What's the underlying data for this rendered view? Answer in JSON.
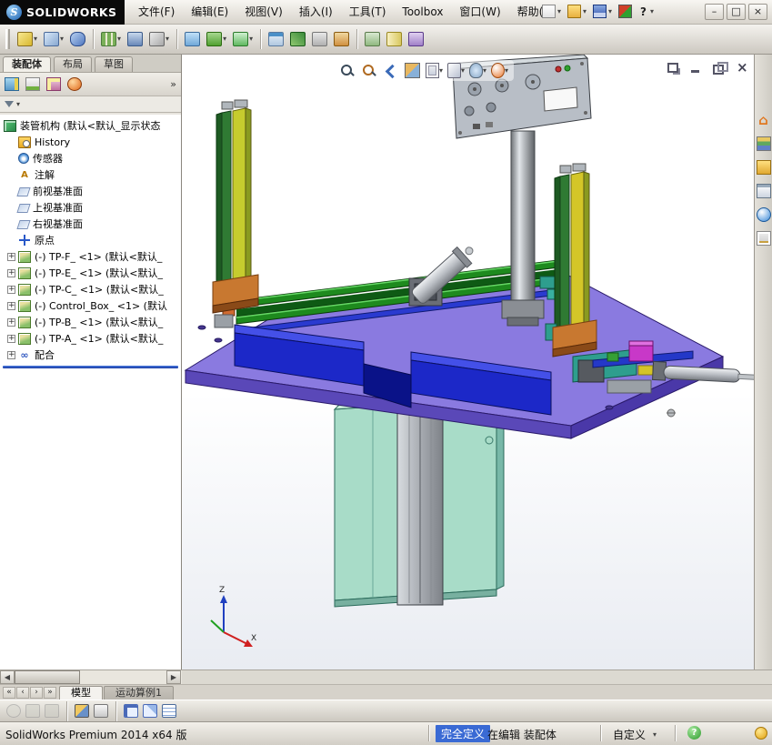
{
  "window": {
    "logo_mark": "S",
    "logo_text": "SOLIDWORKS",
    "menus": [
      "文件(F)",
      "编辑(E)",
      "视图(V)",
      "插入(I)",
      "工具(T)",
      "Toolbox",
      "窗口(W)",
      "帮助(H)"
    ],
    "quick_icons": [
      "new-document-icon",
      "open-document-icon",
      "save-icon",
      "3d-contentcentral-icon"
    ]
  },
  "icons": {
    "dropdown": "▾",
    "help": "?",
    "minimize": "–",
    "restore": "□",
    "close": "×",
    "nav_first": "«",
    "nav_prev": "‹",
    "nav_next": "›",
    "nav_last": "»",
    "overflow": "»",
    "expander": "+",
    "scroll_left": "◀",
    "scroll_right": "▶"
  },
  "assembly_toolbar": [
    "edit-component-icon",
    "insert-components-icon",
    "mate-icon",
    "linear-component-pattern-icon",
    "smart-fasteners-icon",
    "move-component-icon",
    "show-hidden-components-icon",
    "assembly-features-icon",
    "new-motion-study-icon",
    "bill-of-materials-icon",
    "exploded-view-icon",
    "explode-line-sketch-icon",
    "interference-detection-icon",
    "clearance-verification-icon",
    "measure-icon",
    "mass-properties-icon"
  ],
  "panel": {
    "tabs": [
      "装配体",
      "布局",
      "草图"
    ],
    "manager_icons": [
      "featuremanager-tree-icon",
      "propertymanager-icon",
      "configurationmanager-icon",
      "displaymanager-icon"
    ],
    "tree": [
      {
        "label": "装管机构 (默认<默认_显示状态",
        "icon": "assembly-icon"
      },
      {
        "label": "History",
        "icon": "history-icon"
      },
      {
        "label": "传感器",
        "icon": "sensors-icon"
      },
      {
        "label": "注解",
        "icon": "annotations-icon"
      },
      {
        "label": "前视基准面",
        "icon": "plane-icon"
      },
      {
        "label": "上视基准面",
        "icon": "plane-icon"
      },
      {
        "label": "右视基准面",
        "icon": "plane-icon"
      },
      {
        "label": "原点",
        "icon": "origin-icon"
      },
      {
        "label": "(-) TP-F_ <1> (默认<默认_",
        "icon": "component-icon"
      },
      {
        "label": "(-) TP-E_ <1> (默认<默认_",
        "icon": "component-icon"
      },
      {
        "label": "(-) TP-C_ <1> (默认<默认_",
        "icon": "component-icon"
      },
      {
        "label": "(-) Control_Box_ <1> (默认",
        "icon": "component-icon"
      },
      {
        "label": "(-) TP-B_ <1> (默认<默认_",
        "icon": "component-icon"
      },
      {
        "label": "(-) TP-A_ <1> (默认<默认_",
        "icon": "component-icon"
      },
      {
        "label": "配合",
        "icon": "mates-icon"
      }
    ]
  },
  "viewport": {
    "view_toolbar": [
      "zoom-to-fit-icon",
      "zoom-to-area-icon",
      "previous-view-icon",
      "section-view-icon",
      "view-orientation-icon",
      "display-style-icon",
      "hide-show-items-icon",
      "edit-appearance-icon"
    ],
    "doc_controls": [
      "tile-icon",
      "minimize-doc-icon",
      "restore-doc-icon",
      "close-doc-icon"
    ],
    "triad": {
      "z": "Z",
      "x": "X"
    }
  },
  "task_pane": [
    "solidworks-resources-icon",
    "design-library-icon",
    "file-explorer-icon",
    "view-palette-icon",
    "appearances-scenes-icon",
    "custom-properties-icon"
  ],
  "model_colors": {
    "plate": "#8a7ae0",
    "plate_side": "#5a48b8",
    "plate_side2": "#4a38a8",
    "wedge": "#1c28c8",
    "wedge_top": "#4450e8",
    "tower_green": "#2f7a33",
    "tower_yellow": "#c6cc2e",
    "bracket": "#c87830",
    "rail_green": "#1e8a1e",
    "rail_blue": "#2a3ad0",
    "box_teal": "#a8dcc8",
    "panel": "#b8bec6",
    "magenta": "#c838c8",
    "clamp": "#8a8e94"
  },
  "bottom": {
    "doc_tabs": [
      "模型",
      "运动算例1"
    ],
    "bottom_toolbar": [
      "rebuild-icon",
      "visual-properties-icon",
      "deactivate-icon",
      "section-view-bottom-icon",
      "isolate-icon",
      "sketch-icon",
      "reference-triad-icon",
      "evaluate-table-icon"
    ]
  },
  "statusbar": {
    "product": "SolidWorks Premium 2014 x64 版",
    "define_state": "完全定义",
    "edit_state": "在编辑 装配体",
    "custom": "自定义"
  }
}
